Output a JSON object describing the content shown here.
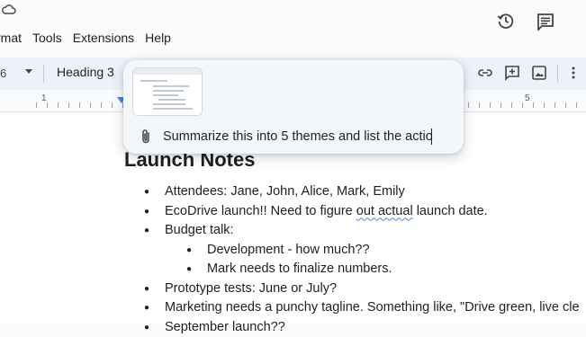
{
  "menubar": {
    "items": [
      "rmat",
      "Tools",
      "Extensions",
      "Help"
    ]
  },
  "toolbar": {
    "zoom_fragment": "6",
    "paragraph_style": "Heading 3"
  },
  "ruler": {
    "labels": [
      "1",
      "5"
    ]
  },
  "prompt": {
    "input_value": "Summarize this into 5 themes and list the actio"
  },
  "document": {
    "heading": "Launch Notes",
    "bullets": [
      {
        "level": 1,
        "text": "Attendees: Jane, John, Alice, Mark, Emily"
      },
      {
        "level": 1,
        "text_before": "EcoDrive launch!! Need to figure ",
        "text_flagged": "out actual",
        "text_after": " launch date."
      },
      {
        "level": 1,
        "text": "Budget talk:"
      },
      {
        "level": 2,
        "text": "Development - how much??"
      },
      {
        "level": 2,
        "text": "Mark needs to finalize numbers."
      },
      {
        "level": 1,
        "text": "Prototype tests: June or July?"
      },
      {
        "level": 1,
        "text": "Marketing needs a punchy tagline. Something like, \"Drive green, live cle"
      },
      {
        "level": 1,
        "text": "September launch??"
      }
    ]
  },
  "icons": {
    "top_left": "cloud-icon",
    "history": "history-icon",
    "comments": "comment-icon",
    "link": "link-icon",
    "insert_comment": "add-comment-icon",
    "image": "image-icon",
    "more": "more-vert-icon",
    "attach": "paperclip-icon"
  },
  "colors": {
    "toolbar_bg": "#edf2fa",
    "accent": "#4f7ddc"
  }
}
